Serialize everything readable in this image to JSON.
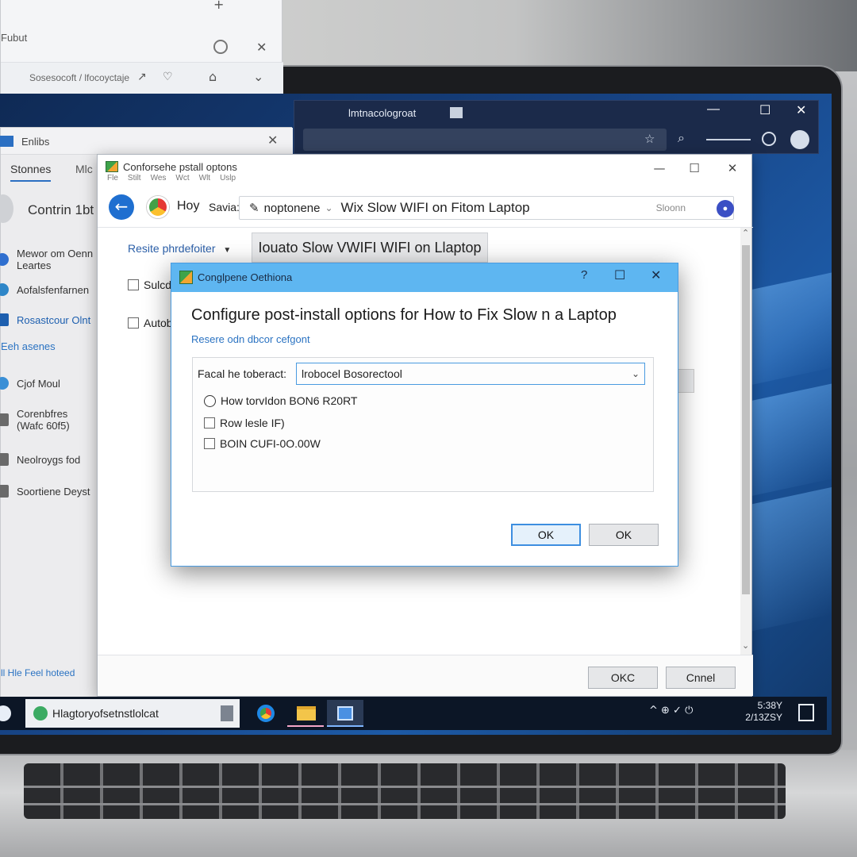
{
  "top_left_window": {
    "label": "Fubut",
    "bar_text": "Sosesocoft / lfocoyctaje",
    "add_glyph": "+",
    "close_glyph": "✕"
  },
  "dark_browser": {
    "title": "lmtnacologroat",
    "min_glyph": "—",
    "max_glyph": "☐",
    "close_glyph": "✕"
  },
  "left_window": {
    "title": "Enlibs",
    "tabs": [
      "Stonnes",
      "Mlc"
    ],
    "section_title": "Contrin 1bt",
    "items": [
      {
        "label": "Mewor om Oenn\nLeartes",
        "color": "#2f6fcf"
      },
      {
        "label": "Aofalsfenfarnen",
        "color": "#2e86c8"
      },
      {
        "label": "Rosastcour Olnt",
        "color": "#1d5faf"
      },
      {
        "label": "Cjof Moul",
        "color": "#3a8fd6"
      },
      {
        "label": "Corenbfres\n(Wafc 60f5)",
        "color": "#6a6a6a"
      },
      {
        "label": "Neolroygs fod",
        "color": "#6a6a6a"
      },
      {
        "label": "Soortiene Deyst",
        "color": "#6a6a6a"
      }
    ],
    "blue_link": "Eeh asenes",
    "footer": "ll Hle  Feel  hoteed"
  },
  "main_window": {
    "title": "Conforsehe pstall optons",
    "menu": [
      "Fle",
      "Stilt",
      "Wes",
      "Wct",
      "Wlt",
      "Uslp"
    ],
    "min_glyph": "—",
    "max_glyph": "☐",
    "close_glyph": "✕",
    "nav_label": "Hoy",
    "nav_label2": "Savia:",
    "url_prefix": "noptonene",
    "url_text": "Wix Slow WIFI on Fitom Laptop",
    "url_suffix": "Sloonn",
    "profile_glyph": "●",
    "dropdown_label": "Resite phrdefoiter",
    "tab_button": "Iouato Slow VWIFI WIFI on Llaptop",
    "checkbox1": "Sulcd",
    "checkbox2": "Autob",
    "ok_label": "OKC",
    "cancel_label": "Cnnel",
    "scroll_up": "⌃",
    "scroll_down": "⌄"
  },
  "dialog": {
    "title": "Conglpene Oethiona",
    "help_glyph": "?",
    "max_glyph": "☐",
    "close_glyph": "✕",
    "heading": "Configure post-install options for  How to Fix Slow n a Laptop",
    "subheading": "Resere odn dbcor cefgont",
    "field_label": "Facal he toberact:",
    "combo_value": "lrobocel Bosorectool",
    "options": [
      {
        "type": "radio",
        "label": "How torvIdon BON6 R20RT"
      },
      {
        "type": "checkbox",
        "label": "Row lesle  IF)"
      },
      {
        "type": "checkbox",
        "label": "BOIN CUFI-0O.00W"
      }
    ],
    "ok_label": "OK",
    "ok2_label": "OK"
  },
  "taskbar": {
    "search_text": "Hlagtoryofsetnstlolcat",
    "time": "5:38Y",
    "date": "2/13ZSY",
    "tray_glyphs": "^  ⊕  ✓  ⏻"
  },
  "colors": {
    "accent": "#1f6fd0",
    "dialog_titlebar": "#5eb6f1",
    "desktop": "#16407f"
  }
}
